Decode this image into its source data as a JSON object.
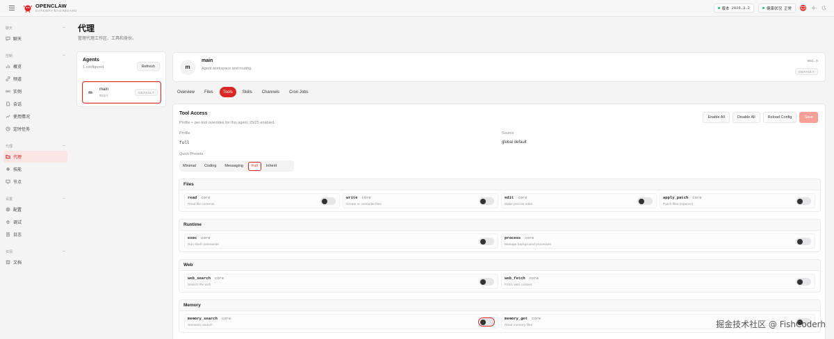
{
  "brand": {
    "name": "OPENCLAW",
    "sub": "GATEWAY DASHBOARD"
  },
  "topbar": {
    "version_label": "版本",
    "version_value": "2026.3.2",
    "health_label": "健康状况",
    "health_value": "正常"
  },
  "sidebar": {
    "groups": [
      {
        "title": "聊天",
        "items": [
          {
            "label": "聊天"
          }
        ]
      },
      {
        "title": "控制",
        "items": [
          {
            "label": "概览"
          },
          {
            "label": "频道"
          },
          {
            "label": "实例"
          },
          {
            "label": "会话"
          },
          {
            "label": "使用情况"
          },
          {
            "label": "定时任务"
          }
        ]
      },
      {
        "title": "代理",
        "items": [
          {
            "label": "代理"
          },
          {
            "label": "技能"
          },
          {
            "label": "节点"
          }
        ]
      },
      {
        "title": "设置",
        "items": [
          {
            "label": "配置"
          },
          {
            "label": "调试"
          },
          {
            "label": "日志"
          }
        ]
      },
      {
        "title": "资源",
        "items": [
          {
            "label": "文档"
          }
        ]
      }
    ]
  },
  "page": {
    "title": "代理",
    "subtitle": "管理代理工作区、工具和身份。"
  },
  "agents": {
    "title": "Agents",
    "count": "1 configured.",
    "refresh": "Refresh",
    "list": [
      {
        "avatar": "m",
        "name": "main",
        "id": "main",
        "badge": "DEFAULT"
      }
    ]
  },
  "head": {
    "avatar": "m",
    "name": "main",
    "desc": "Agent workspace and routing.",
    "id": "mai.n",
    "badge": "DEFAULT"
  },
  "tabs": [
    "Overview",
    "Files",
    "Tools",
    "Skills",
    "Channels",
    "Cron Jobs"
  ],
  "active_tab": "Tools",
  "tools": {
    "title": "Tool Access",
    "subtitle": "Profile + per-tool overrides for this agent. 25/25 enabled.",
    "actions": {
      "enable_all": "Enable All",
      "disable_all": "Disable All",
      "reload": "Reload Config",
      "save": "Save"
    },
    "profile_label": "Profile",
    "profile_value": "full",
    "source_label": "Source",
    "source_value": "global default",
    "presets_label": "Quick Presets",
    "presets": [
      "Minimal",
      "Coding",
      "Messaging",
      "Full",
      "Inherit"
    ],
    "active_preset": "Full",
    "sections": [
      {
        "title": "Files",
        "tools": [
          {
            "name": "read",
            "tag": "core",
            "desc": "Read file contents"
          },
          {
            "name": "write",
            "tag": "core",
            "desc": "Create or overwrite files"
          },
          {
            "name": "edit",
            "tag": "core",
            "desc": "Make precise edits"
          },
          {
            "name": "apply_patch",
            "tag": "core",
            "desc": "Patch files (OpenAI)"
          }
        ]
      },
      {
        "title": "Runtime",
        "tools": [
          {
            "name": "exec",
            "tag": "core",
            "desc": "Run shell commands"
          },
          {
            "name": "process",
            "tag": "core",
            "desc": "Manage background processes"
          }
        ]
      },
      {
        "title": "Web",
        "tools": [
          {
            "name": "web_search",
            "tag": "core",
            "desc": "Search the web"
          },
          {
            "name": "web_fetch",
            "tag": "core",
            "desc": "Fetch web content"
          }
        ]
      },
      {
        "title": "Memory",
        "tools": [
          {
            "name": "memory_search",
            "tag": "core",
            "desc": "Semantic search"
          },
          {
            "name": "memory_get",
            "tag": "core",
            "desc": "Read memory files"
          }
        ]
      }
    ]
  },
  "watermark": "掘金技术社区 @ FishCoderh"
}
